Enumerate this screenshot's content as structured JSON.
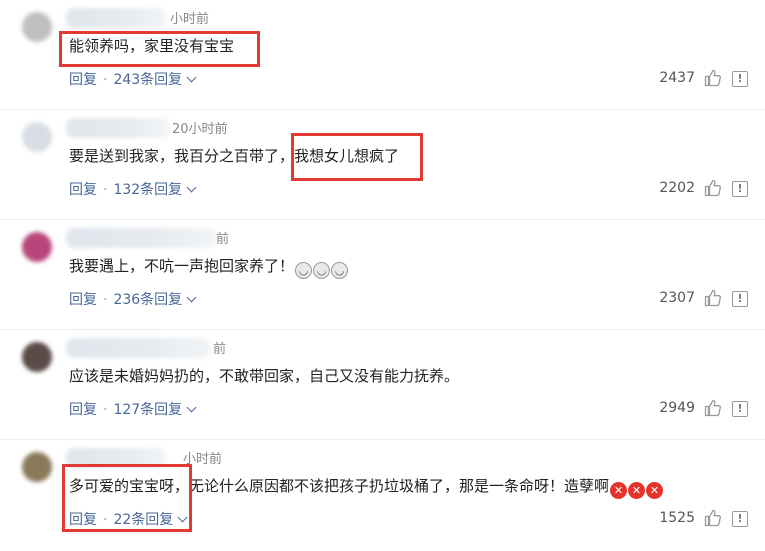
{
  "comments": [
    {
      "time": "小时前",
      "text": "能领养吗，家里没有宝宝",
      "emojis": [],
      "reply_label": "回复",
      "separator": "·",
      "reply_count_label": "243条回复",
      "likes": "2437",
      "report_glyph": "!",
      "avatar_color": "#bfbfbf"
    },
    {
      "time": "20小时前",
      "text": "要是送到我家，我百分之百带了，我想女儿想疯了",
      "emojis": [],
      "reply_label": "回复",
      "separator": "·",
      "reply_count_label": "132条回复",
      "likes": "2202",
      "report_glyph": "!",
      "avatar_color": "#d8dde3"
    },
    {
      "time": "前",
      "text": "我要遇上，不吭一声抱回家养了！",
      "emojis": [
        "smile-emoji",
        "smile-emoji",
        "smile-emoji"
      ],
      "reply_label": "回复",
      "separator": "·",
      "reply_count_label": "236条回复",
      "likes": "2307",
      "report_glyph": "!",
      "avatar_color": "#b8467a"
    },
    {
      "time": "前",
      "text": "应该是未婚妈妈扔的，不敢带回家，自己又没有能力抚养。",
      "emojis": [],
      "reply_label": "回复",
      "separator": "·",
      "reply_count_label": "127条回复",
      "likes": "2949",
      "report_glyph": "!",
      "avatar_color": "#5a4a48"
    },
    {
      "time": "小时前",
      "text": "多可爱的宝宝呀，无论什么原因都不该把孩子扔垃圾桶了，那是一条命呀！造孽啊",
      "emojis": [
        "angry-emoji",
        "angry-emoji",
        "angry-emoji"
      ],
      "reply_label": "回复",
      "separator": "·",
      "reply_count_label": "22条回复",
      "likes": "1525",
      "report_glyph": "!",
      "avatar_color": "#8a7a5a"
    }
  ],
  "colors": {
    "link": "#48679a",
    "highlight": "#e03a33",
    "divider": "#eeeeee"
  }
}
